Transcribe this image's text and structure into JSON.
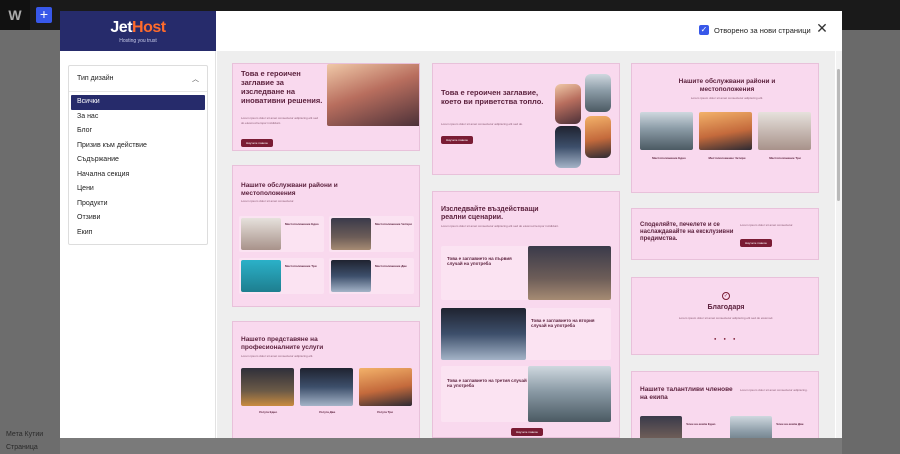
{
  "modal": {
    "logo": {
      "brand_main": "Jet",
      "brand_accent": "Host",
      "tagline": "Hosting you trust"
    },
    "filter": {
      "title": "Тип дизайн",
      "categories": [
        "Всички",
        "За нас",
        "Блог",
        "Призив към действие",
        "Съдържание",
        "Начална секция",
        "Цени",
        "Продукти",
        "Отзиви",
        "Екип"
      ],
      "selected": "Всички"
    },
    "open_new_pages_label": "Отворено за нови страници",
    "accent_color": "#262b6b",
    "checkbox_color": "#3858e9"
  },
  "background": {
    "footer_items": [
      "Мета Кутии",
      "Страница"
    ]
  },
  "patterns": {
    "c1_title": "Това е героичен заглавие за изследване на иновативни решения.",
    "c1_btn": "Научете повече",
    "c2_title": "Нашите обслужвани райони и местоположения",
    "c2_items": [
      "Местоположение Едно",
      "Местоположение Четири",
      "Местоположение Три",
      "Местоположение Две"
    ],
    "c3_title": "Нашето представяне на професионалните услуги",
    "c3_items": [
      "Услуга Едно",
      "Услуга Две",
      "Услуга Три"
    ],
    "c4_title": "Това е героичен заглавие, което ви приветства топло.",
    "c4_btn": "Научете повече",
    "c5_title": "Изследвайте въздействащи реални сценарии.",
    "c5_cases": [
      "Това е заглавието на първия случай на употреба",
      "Това е заглавието на втория случай на употреба",
      "Това е заглавието на третия случай на употреба"
    ],
    "c5_btn": "Научете повече",
    "c6_title": "Нашите обслужвани райони и местоположения",
    "c6_items": [
      "Местоположение Едно",
      "Местоположение Четири",
      "Местоположение Три"
    ],
    "c7_title": "Споделяйте, печелете и се наслаждавайте на ексклузивни предимства.",
    "c7_btn": "Научете повече",
    "c8_title": "Благодаря",
    "c9_title": "Нашите талантливи членове на екипа",
    "c9_names": [
      "Член на екипа Едно",
      "Член на екипа Две"
    ]
  }
}
